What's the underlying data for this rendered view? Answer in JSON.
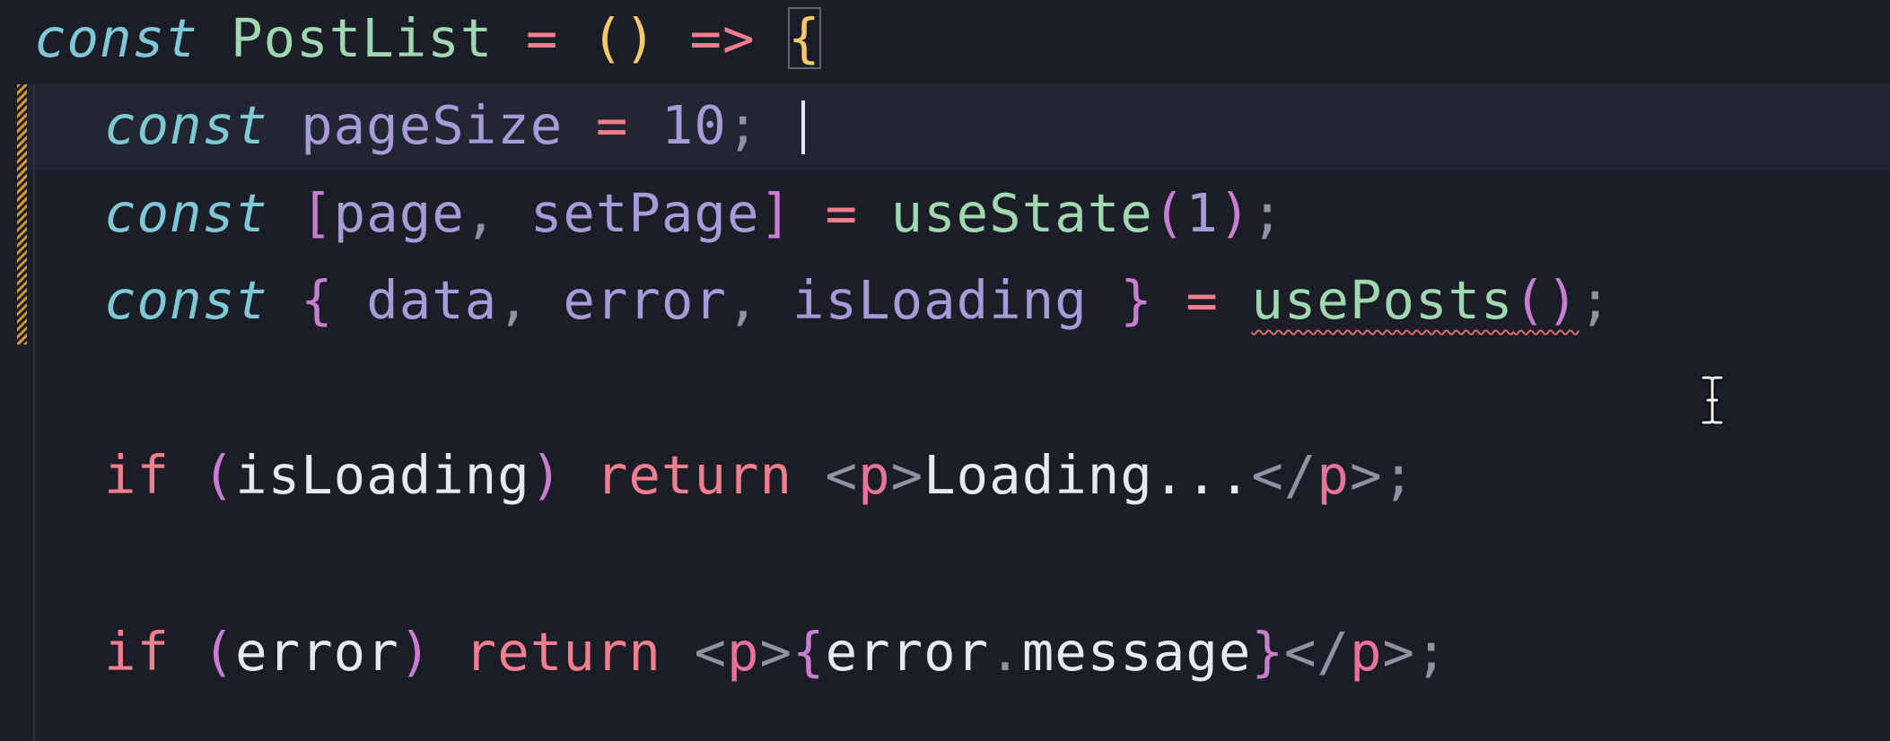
{
  "colors": {
    "background": "#1b1e27",
    "current_line": "#222632",
    "keyword_const": "#7ec8d6",
    "keyword_flow": "#f07e8f",
    "function": "#9fd7b0",
    "variable": "#a79ad8",
    "error_squiggle": "#e06a6a",
    "git_modified": "#d9962c"
  },
  "code": {
    "line1": {
      "kw": "const",
      "name": "PostList",
      "eq": "=",
      "parens": "()",
      "arrow": "=>",
      "brace": "{"
    },
    "line2": {
      "kw": "const",
      "name": "pageSize",
      "eq": "=",
      "value": "10",
      "semi": ";"
    },
    "line3": {
      "kw": "const",
      "lb": "[",
      "var1": "page",
      "comma": ",",
      "var2": "setPage",
      "rb": "]",
      "eq": "=",
      "fn": "useState",
      "lp": "(",
      "arg": "1",
      "rp": ")",
      "semi": ";"
    },
    "line4": {
      "kw": "const",
      "lb": "{",
      "var1": "data",
      "c1": ",",
      "var2": "error",
      "c2": ",",
      "var3": "isLoading",
      "rb": "}",
      "eq": "=",
      "fn": "usePosts",
      "parens": "()",
      "semi": ";"
    },
    "line5": {
      "kw": "if",
      "lp": "(",
      "cond": "isLoading",
      "rp": ")",
      "ret": "return",
      "open_lt": "<",
      "open_tag": "p",
      "open_gt": ">",
      "text": "Loading...",
      "close_lt": "</",
      "close_tag": "p",
      "close_gt": ">",
      "semi": ";"
    },
    "line6": {
      "kw": "if",
      "lp": "(",
      "cond": "error",
      "rp": ")",
      "ret": "return",
      "open_lt": "<",
      "open_tag": "p",
      "open_gt": ">",
      "expr_lb": "{",
      "expr_obj": "error",
      "expr_dot": ".",
      "expr_prop": "message",
      "expr_rb": "}",
      "close_lt": "</",
      "close_tag": "p",
      "close_gt": ">",
      "semi": ";"
    }
  }
}
